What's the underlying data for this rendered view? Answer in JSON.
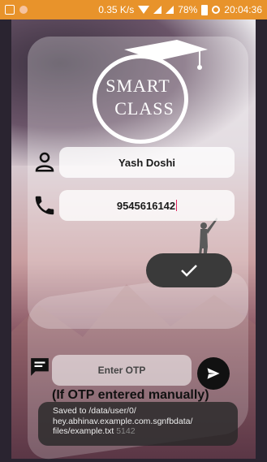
{
  "status_bar": {
    "speed": "0.35 K/s",
    "battery": "78%",
    "time": "20:04:36"
  },
  "logo": {
    "line1": "SMART",
    "line2": "CLASS"
  },
  "form": {
    "name_value": "Yash Doshi",
    "phone_value": "9545616142",
    "otp_placeholder": "Enter OTP",
    "manual_note": "(If OTP entered manually)"
  },
  "toast": {
    "line1": "Saved to /data/user/0/",
    "line2": "hey.abhinav.example.com.sgnfbdata/",
    "line3": "files/example.txt",
    "ghost": "5142"
  },
  "colors": {
    "status_bar": "#e8932b",
    "button_dark": "#3a3a3a"
  }
}
